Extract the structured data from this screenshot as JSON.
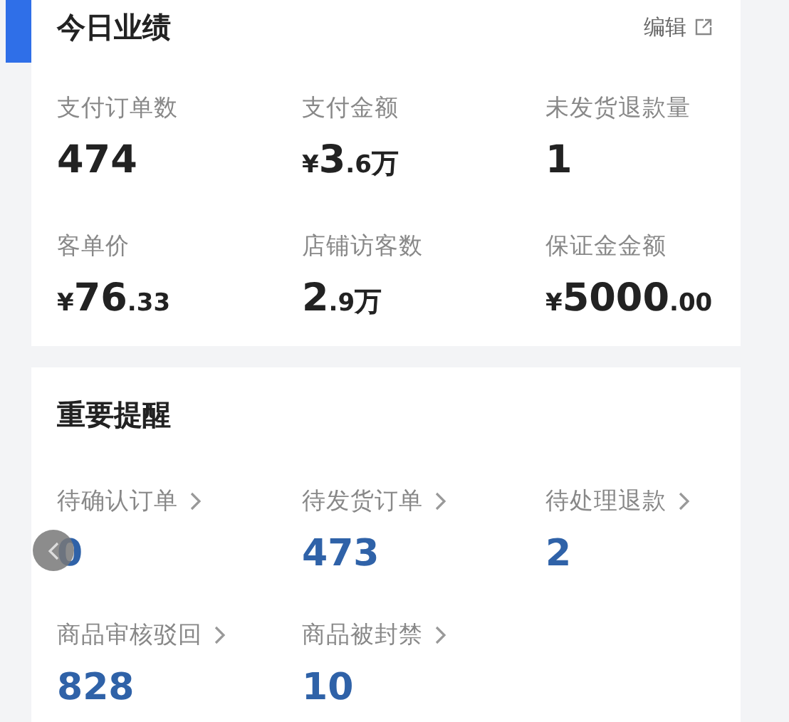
{
  "performance": {
    "title": "今日业绩",
    "edit_label": "编辑",
    "metrics": [
      {
        "label": "支付订单数",
        "value": [
          {
            "text": "474",
            "kind": "major"
          }
        ]
      },
      {
        "label": "支付金额",
        "value": [
          {
            "text": "¥",
            "kind": "minor"
          },
          {
            "text": "3",
            "kind": "major"
          },
          {
            "text": ".6",
            "kind": "minor"
          },
          {
            "text": "万",
            "kind": "unit"
          }
        ]
      },
      {
        "label": "未发货退款量",
        "value": [
          {
            "text": "1",
            "kind": "major"
          }
        ]
      },
      {
        "label": "客单价",
        "value": [
          {
            "text": "¥",
            "kind": "minor"
          },
          {
            "text": "76",
            "kind": "major"
          },
          {
            "text": ".33",
            "kind": "minor"
          }
        ]
      },
      {
        "label": "店铺访客数",
        "value": [
          {
            "text": "2",
            "kind": "major"
          },
          {
            "text": ".9",
            "kind": "minor"
          },
          {
            "text": "万",
            "kind": "unit"
          }
        ]
      },
      {
        "label": "保证金金额",
        "value": [
          {
            "text": "¥",
            "kind": "minor"
          },
          {
            "text": "5000",
            "kind": "major"
          },
          {
            "text": ".00",
            "kind": "minor"
          }
        ]
      }
    ]
  },
  "reminders": {
    "title": "重要提醒",
    "items": [
      {
        "label": "待确认订单",
        "value": "0"
      },
      {
        "label": "待发货订单",
        "value": "473"
      },
      {
        "label": "待处理退款",
        "value": "2"
      },
      {
        "label": "商品审核驳回",
        "value": "828"
      },
      {
        "label": "商品被封禁",
        "value": "10"
      }
    ]
  }
}
